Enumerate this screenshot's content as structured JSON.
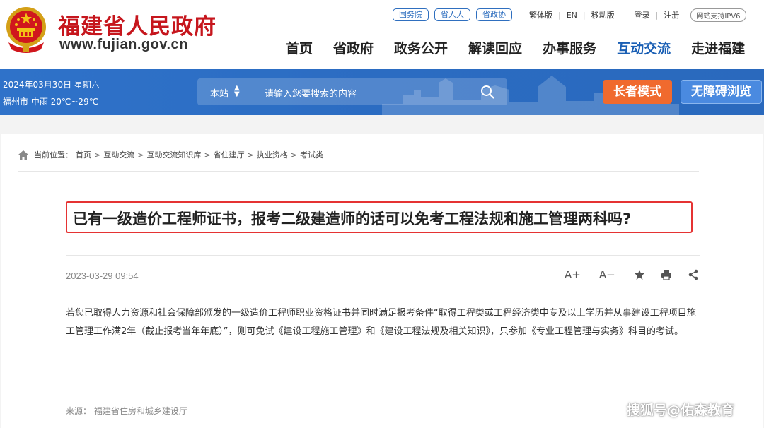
{
  "header": {
    "site_name": "福建省人民政府",
    "site_domain": "www.fujian.gov.cn",
    "top_pills": [
      "国务院",
      "省人大",
      "省政协"
    ],
    "top_links": [
      "繁体版",
      "EN",
      "移动版"
    ],
    "login": "登录",
    "register": "注册",
    "ipv6": "网站支持IPV6",
    "nav": [
      "首页",
      "省政府",
      "政务公开",
      "解读回应",
      "办事服务",
      "互动交流",
      "走进福建"
    ],
    "active_nav": "互动交流"
  },
  "band": {
    "date": "2024年03月30日 星期六",
    "weather": "福州市 中雨 20℃~29℃",
    "search_scope": "本站",
    "search_placeholder": "请输入您要搜索的内容",
    "elder_mode": "长者模式",
    "accessible": "无障碍浏览"
  },
  "breadcrumb": {
    "label": "当前位置：",
    "items": [
      "首页",
      "互动交流",
      "互动交流知识库",
      "省住建厅",
      "执业资格",
      "考试类"
    ]
  },
  "article": {
    "title": "已有一级造价工程师证书，报考二级建造师的话可以免考工程法规和施工管理两科吗?",
    "date": "2023-03-29 09:54",
    "tools": [
      "A+",
      "A−"
    ],
    "body": "若您已取得人力资源和社会保障部颁发的一级造价工程师职业资格证书并同时满足报考条件“取得工程类或工程经济类中专及以上学历并从事建设工程项目施工管理工作满2年（截止报考当年年底）”，则可免试《建设工程施工管理》和《建设工程法规及相关知识》，只参加《专业工程管理与实务》科目的考试。",
    "source": "来源：  福建省住房和城乡建设厅"
  },
  "watermark": "搜狐号@佑森教育",
  "colors": {
    "brand_red": "#c6161d",
    "nav_active": "#1a5fb4",
    "band_blue": "#2c6dc3",
    "elder_orange": "#f06a2e",
    "title_border": "#e53333"
  }
}
